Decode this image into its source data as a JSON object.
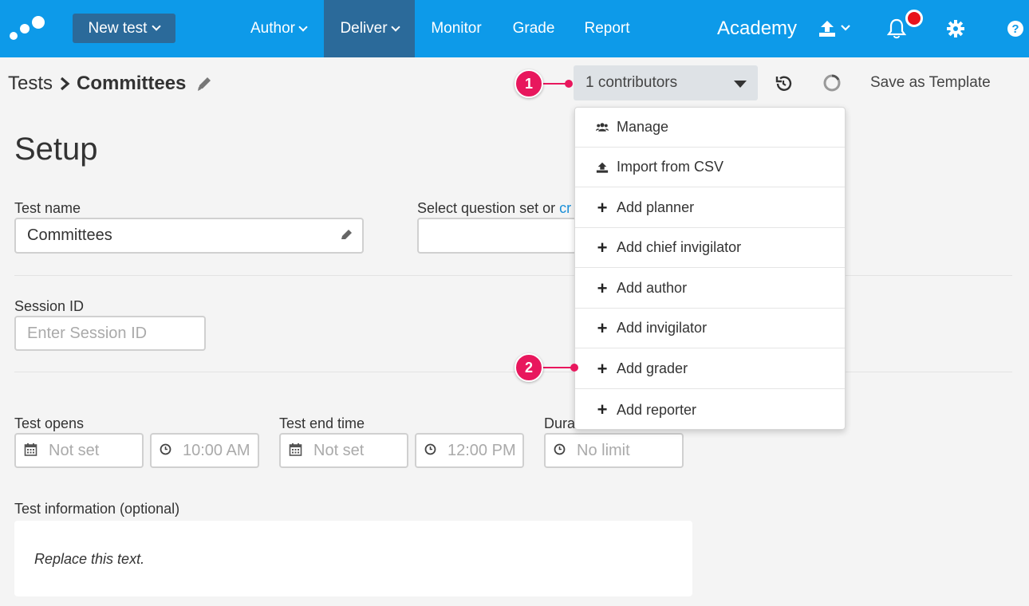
{
  "nav": {
    "new_test": "New test",
    "items": [
      "Author",
      "Deliver",
      "Monitor",
      "Grade",
      "Report"
    ],
    "active": "Deliver",
    "academy": "Academy",
    "icons": [
      "upload-icon",
      "bell-icon",
      "gear-icon",
      "help-icon"
    ]
  },
  "breadcrumb": {
    "root": "Tests",
    "current": "Committees"
  },
  "toolbar": {
    "contributors": "1 contributors",
    "save_template": "Save as Template"
  },
  "callouts": [
    "1",
    "2"
  ],
  "setup": {
    "title": "Setup",
    "test_name_label": "Test name",
    "test_name_value": "Committees",
    "question_set_label": "Select question set or ",
    "question_set_link": "cr",
    "session_label": "Session ID",
    "session_placeholder": "Enter Session ID",
    "opens_label": "Test opens",
    "opens_date": "Not set",
    "opens_time": "10:00 AM",
    "end_label": "Test end time",
    "end_date": "Not set",
    "end_time": "12:00 PM",
    "duration_label": "Dura",
    "duration_value": "No limit",
    "info_label": "Test information (optional)",
    "info_text": "Replace this text."
  },
  "dropdown": {
    "items": [
      {
        "label": "Manage",
        "icon": "users-icon"
      },
      {
        "label": "Import from CSV",
        "icon": "upload-icon"
      },
      {
        "label": "Add planner",
        "icon": "plus-icon"
      },
      {
        "label": "Add chief invigilator",
        "icon": "plus-icon"
      },
      {
        "label": "Add author",
        "icon": "plus-icon"
      },
      {
        "label": "Add invigilator",
        "icon": "plus-icon"
      },
      {
        "label": "Add grader",
        "icon": "plus-icon"
      },
      {
        "label": "Add reporter",
        "icon": "plus-icon"
      }
    ]
  },
  "colors": {
    "nav_bg": "#0d9ae9",
    "nav_active": "#2b6a9a",
    "callout": "#e8175d",
    "notif": "#e8131c"
  }
}
